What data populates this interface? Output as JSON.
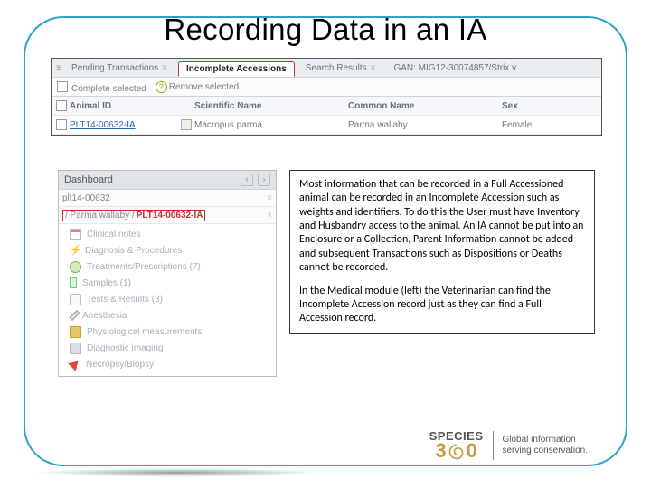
{
  "title": "Recording Data in an IA",
  "topPanel": {
    "tabs": {
      "pending": "Pending Transactions",
      "incomplete": "Incomplete Accessions",
      "search": "Search Results",
      "gan": "GAN: MIG12-30074857/Strix v"
    },
    "toolbar": {
      "complete": "Complete selected",
      "remove": "Remove selected"
    },
    "columns": {
      "animalId": "Animal ID",
      "sciName": "Scientific Name",
      "commonName": "Common Name",
      "sex": "Sex"
    },
    "row": {
      "animalId": "PLT14-00632-IA",
      "sciName": "Macropus parma",
      "commonName": "Parma wallaby",
      "sex": "Female"
    }
  },
  "dashboard": {
    "header": "Dashboard",
    "crumb1": "plt14-00632",
    "crumb2prefix": "/ Parma wallaby /",
    "crumb2link": "PLT14-00632-IA",
    "tree": [
      {
        "label": "Clinical notes"
      },
      {
        "label": "Diagnosis & Procedures"
      },
      {
        "label": "Treatments/Prescriptions (7)"
      },
      {
        "label": "Samples (1)"
      },
      {
        "label": "Tests & Results (3)"
      },
      {
        "label": "Anesthesia"
      },
      {
        "label": "Physiological measurements"
      },
      {
        "label": "Diagnostic imaging"
      },
      {
        "label": "Necropsy/Biopsy"
      }
    ]
  },
  "paragraph1": "Most information that can be recorded in a Full Accessioned animal can be recorded in an Incomplete Accession such as weights and identifiers. To do this the User must have Inventory and Husbandry access to the animal. An IA cannot be put into an Enclosure or a Collection, Parent Information cannot be added and subsequent Transactions such as Dispositions or Deaths cannot be recorded.",
  "paragraph2": "In the Medical module (left) the Veterinarian can find the Incomplete Accession record just as they can find a Full Accession record.",
  "footer": {
    "brandTop": "SPECIES",
    "brand3": "3",
    "brand0": "0",
    "tagline1": "Global information",
    "tagline2": "serving conservation."
  }
}
